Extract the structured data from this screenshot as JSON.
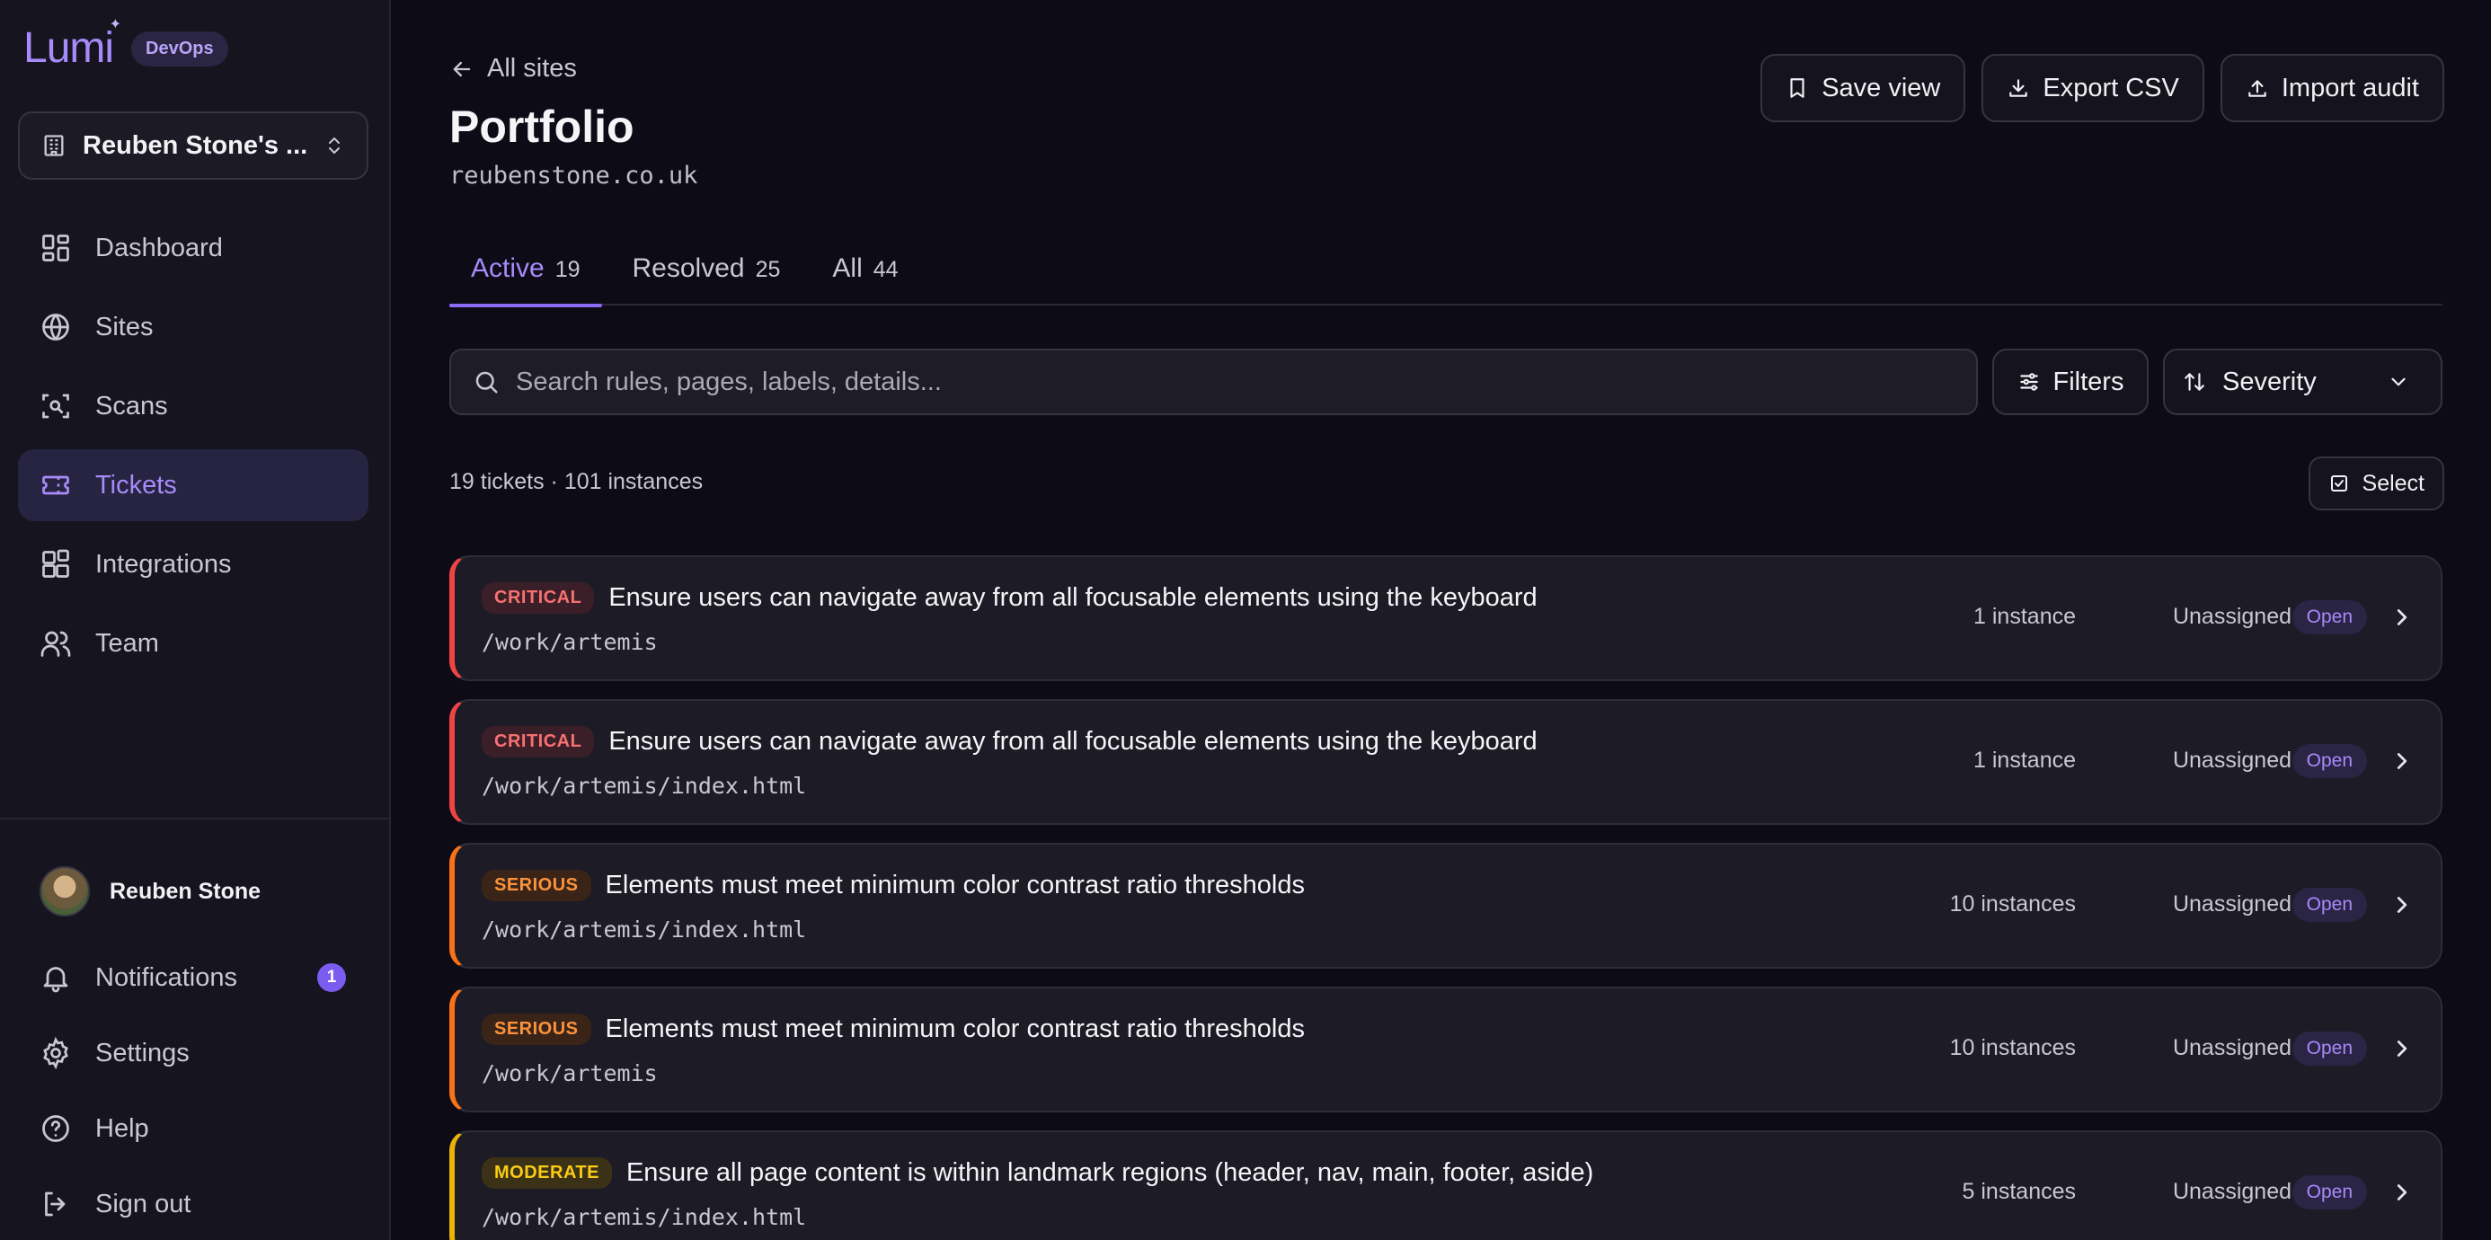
{
  "brand": {
    "logo": "Lumi",
    "env": "DevOps"
  },
  "org": {
    "name": "Reuben Stone's ..."
  },
  "nav": [
    {
      "label": "Dashboard",
      "icon": "dashboard-icon"
    },
    {
      "label": "Sites",
      "icon": "globe-icon"
    },
    {
      "label": "Scans",
      "icon": "scan-icon"
    },
    {
      "label": "Tickets",
      "icon": "ticket-icon",
      "active": true
    },
    {
      "label": "Integrations",
      "icon": "integrations-icon"
    },
    {
      "label": "Team",
      "icon": "team-icon"
    }
  ],
  "user": {
    "name": "Reuben Stone"
  },
  "footer": {
    "notifications": "Notifications",
    "notifications_count": "1",
    "settings": "Settings",
    "help": "Help",
    "signout": "Sign out"
  },
  "header": {
    "back": "All sites",
    "title": "Portfolio",
    "domain": "reubenstone.co.uk",
    "actions": {
      "save": "Save view",
      "export": "Export CSV",
      "import": "Import audit"
    }
  },
  "tabs": [
    {
      "label": "Active",
      "count": "19"
    },
    {
      "label": "Resolved",
      "count": "25"
    },
    {
      "label": "All",
      "count": "44"
    }
  ],
  "toolbar": {
    "search_placeholder": "Search rules, pages, labels, details...",
    "filters": "Filters",
    "sort": "Severity"
  },
  "summary": "19 tickets · 101 instances",
  "select_label": "Select",
  "tickets": [
    {
      "severity": "CRITICAL",
      "title": "Ensure users can navigate away from all focusable elements using the keyboard",
      "path": "/work/artemis",
      "instances": "1 instance",
      "assignee": "Unassigned",
      "status": "Open"
    },
    {
      "severity": "CRITICAL",
      "title": "Ensure users can navigate away from all focusable elements using the keyboard",
      "path": "/work/artemis/index.html",
      "instances": "1 instance",
      "assignee": "Unassigned",
      "status": "Open"
    },
    {
      "severity": "SERIOUS",
      "title": "Elements must meet minimum color contrast ratio thresholds",
      "path": "/work/artemis/index.html",
      "instances": "10 instances",
      "assignee": "Unassigned",
      "status": "Open"
    },
    {
      "severity": "SERIOUS",
      "title": "Elements must meet minimum color contrast ratio thresholds",
      "path": "/work/artemis",
      "instances": "10 instances",
      "assignee": "Unassigned",
      "status": "Open"
    },
    {
      "severity": "MODERATE",
      "title": "Ensure all page content is within landmark regions (header, nav, main, footer, aside)",
      "path": "/work/artemis/index.html",
      "instances": "5 instances",
      "assignee": "Unassigned",
      "status": "Open"
    }
  ],
  "colors": {
    "accent": "#a78bfa",
    "critical": "#ef4444",
    "serious": "#f97316",
    "moderate": "#eab308",
    "background": "#0c0b16",
    "sidebar": "#16151f"
  }
}
